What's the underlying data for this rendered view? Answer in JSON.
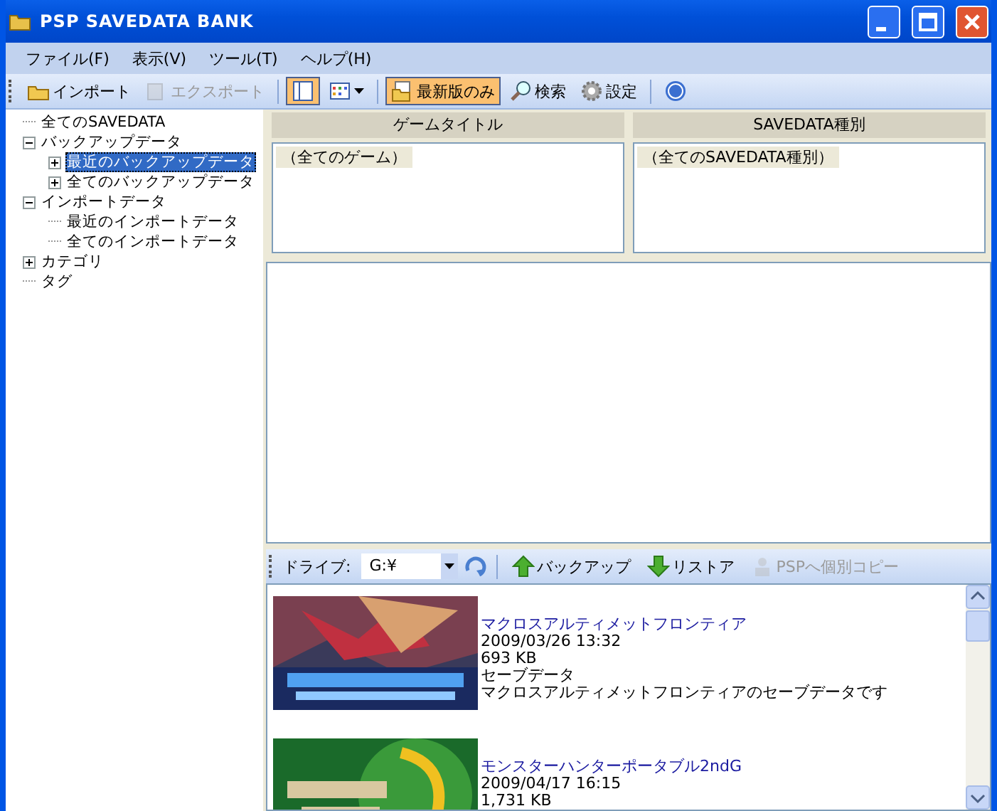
{
  "window": {
    "title": "PSP SAVEDATA BANK"
  },
  "menu": [
    "ファイル(F)",
    "表示(V)",
    "ツール(T)",
    "ヘルプ(H)"
  ],
  "toolbar": [
    {
      "kind": "button",
      "label": "インポート",
      "disabled": false,
      "pressed": false
    },
    {
      "kind": "button",
      "label": "エクスポート",
      "disabled": true,
      "pressed": false
    },
    {
      "kind": "separator"
    },
    {
      "kind": "button",
      "pressed": true
    },
    {
      "kind": "dropdown",
      "pressed": false
    },
    {
      "kind": "separator"
    },
    {
      "kind": "button",
      "label": "最新版のみ",
      "pressed": true
    },
    {
      "kind": "button",
      "label": "検索",
      "pressed": false
    },
    {
      "kind": "button",
      "label": "設定",
      "pressed": false
    },
    {
      "kind": "separator"
    },
    {
      "kind": "button",
      "pressed": false
    }
  ],
  "tree": [
    {
      "label": "全てのSAVEDATA",
      "selected": false
    },
    {
      "label": "バックアップデータ",
      "expanded": true,
      "selected": false,
      "children": [
        {
          "label": "最近のバックアップデータ",
          "expanded": false,
          "selected": true
        },
        {
          "label": "全てのバックアップデータ",
          "expanded": false,
          "selected": false
        }
      ]
    },
    {
      "label": "インポートデータ",
      "expanded": true,
      "selected": false,
      "children": [
        {
          "label": "最近のインポートデータ",
          "selected": false
        },
        {
          "label": "全てのインポートデータ",
          "selected": false
        }
      ]
    },
    {
      "label": "カテゴリ",
      "expanded": false,
      "selected": false
    },
    {
      "label": "タグ",
      "selected": false
    }
  ],
  "filters": [
    {
      "heading": "ゲームタイトル",
      "items": [
        "（全てのゲーム）"
      ]
    },
    {
      "heading": "SAVEDATA種別",
      "items": [
        "（全てのSAVEDATA種別）"
      ]
    }
  ],
  "drive_toolbar": {
    "label": "ドライブ:",
    "drive": "G:¥",
    "buttons": [
      {
        "label": "バックアップ",
        "disabled": false
      },
      {
        "label": "リストア",
        "disabled": false
      },
      {
        "label": "PSPへ個別コピー",
        "disabled": true
      }
    ]
  },
  "saves": [
    {
      "kind": "picture",
      "title": "マクロスアルティメットフロンティア",
      "date": "2009/03/26 13:32",
      "size": "693 KB",
      "type": "セーブデータ",
      "description": "マクロスアルティメットフロンティアのセーブデータです"
    },
    {
      "kind": "picture",
      "title": "モンスターハンターポータブル2ndG",
      "date": "2009/04/17 16:15",
      "size": "1,731 KB"
    }
  ]
}
